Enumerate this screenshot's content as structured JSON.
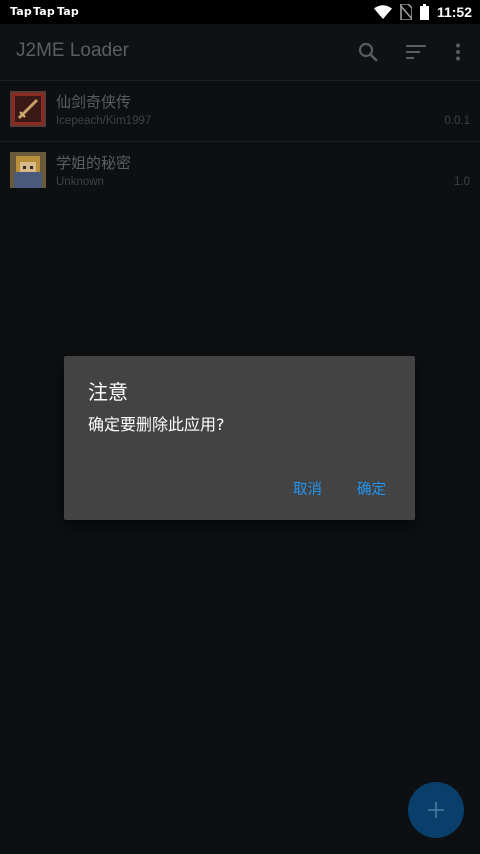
{
  "status_bar": {
    "notifications": [
      "Tap",
      "Tap",
      "Tap"
    ],
    "time": "11:52",
    "icons": [
      "wifi-icon",
      "no-sim-icon",
      "battery-icon"
    ]
  },
  "toolbar": {
    "title": "J2ME Loader",
    "actions": [
      "search-icon",
      "sort-icon",
      "more-vert-icon"
    ]
  },
  "apps": [
    {
      "title": "仙剑奇侠传",
      "author": "Icepeach/Kim1997",
      "version": "0.0.1"
    },
    {
      "title": "学姐的秘密",
      "author": "Unknown",
      "version": "1.0"
    }
  ],
  "dialog": {
    "title": "注意",
    "message": "确定要删除此应用?",
    "cancel_label": "取消",
    "confirm_label": "确定"
  },
  "fab": {
    "icon": "add-icon"
  },
  "colors": {
    "background": "#0d0f12",
    "dialog_bg": "#434343",
    "accent": "#2196f3",
    "fab_bg": "#0a3f6b"
  }
}
